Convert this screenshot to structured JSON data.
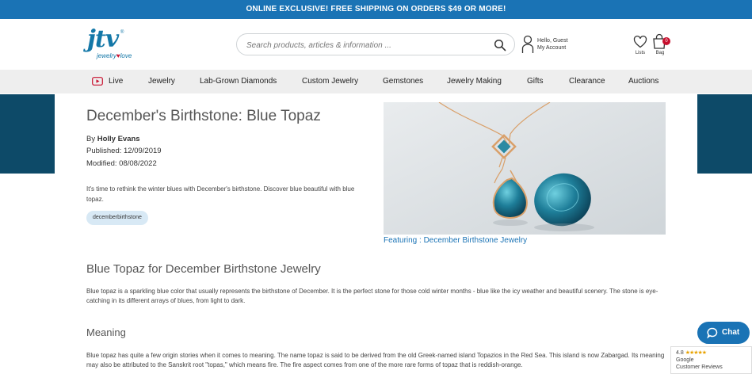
{
  "promo": {
    "text": "ONLINE EXCLUSIVE! FREE SHIPPING ON ORDERS $49 OR MORE!"
  },
  "logo": {
    "brand": "jtv",
    "reg": "®",
    "sub_jewelry": "jewelry",
    "sub_love": "love"
  },
  "search": {
    "placeholder": "Search products, articles & information ..."
  },
  "account": {
    "greeting": "Hello, Guest",
    "label": "My Account"
  },
  "header_icons": {
    "lists_label": "Lists",
    "bag_label": "Bag",
    "bag_count": "0"
  },
  "nav": {
    "items": [
      {
        "label": "Live"
      },
      {
        "label": "Jewelry"
      },
      {
        "label": "Lab-Grown Diamonds"
      },
      {
        "label": "Custom Jewelry"
      },
      {
        "label": "Gemstones"
      },
      {
        "label": "Jewelry Making"
      },
      {
        "label": "Gifts"
      },
      {
        "label": "Clearance"
      },
      {
        "label": "Auctions"
      }
    ]
  },
  "article": {
    "title": "December's Birthstone: Blue Topaz",
    "by_prefix": "By ",
    "author": "Holly Evans",
    "published": "Published: 12/09/2019",
    "modified": "Modified: 08/08/2022",
    "intro": "It's time to rethink the winter blues with December's birthstone. Discover blue beautiful with blue topaz.",
    "tag": "decemberbirthstone",
    "image_caption": "Featuring : December Birthstone Jewelry",
    "section_title": "Blue Topaz for December Birthstone Jewelry",
    "section_para": "Blue topaz is a sparkling blue color that usually represents the birthstone of December. It is the perfect stone for those cold winter months - blue like the icy weather and beautiful scenery. The stone is eye-catching in its different arrays of blues, from light to dark.",
    "meaning_title": "Meaning",
    "meaning_para": "Blue topaz has quite a few origin stories when it comes to meaning. The name topaz is said to be derived from the old Greek-named island Topazios in the Red Sea. This island is now Zabargad. Its meaning may also be attributed to the Sanskrit root \"topas,\" which means fire. The fire aspect comes from one of the more rare forms of topaz that is reddish-orange."
  },
  "chat": {
    "label": "Chat"
  },
  "reviews": {
    "rating": "4.8",
    "stars": "★★★★★",
    "source": "Google",
    "label": "Customer Reviews"
  },
  "colors": {
    "brand_blue": "#1a73b5",
    "side_panel": "#0d4a68",
    "nav_bg": "#eeeeee",
    "accent_red": "#c8102e"
  }
}
